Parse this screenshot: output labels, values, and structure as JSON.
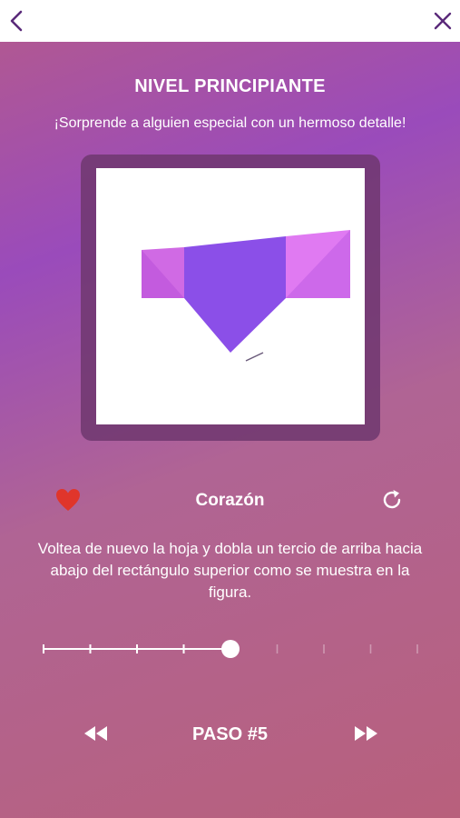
{
  "header": {
    "back_icon": "chevron-left-icon",
    "close_icon": "close-icon",
    "icon_color": "#5a2a7a"
  },
  "level": {
    "title": "NIVEL PRINCIPIANTE",
    "subtitle": "¡Sorprende a alguien especial con un hermoso detalle!"
  },
  "figure": {
    "name": "Corazón",
    "favorite_icon": "heart-icon",
    "favorite_color": "#e0352b",
    "reset_icon": "refresh-icon"
  },
  "instructions": "Voltea de nuevo la hoja y dobla un tercio de arriba hacia abajo del rectángulo superior como se muestra en la figura.",
  "progress": {
    "current_step": 5,
    "total_steps": 9
  },
  "navigation": {
    "step_label": "PASO #5",
    "prev_icon": "rewind-icon",
    "next_icon": "fast-forward-icon"
  }
}
